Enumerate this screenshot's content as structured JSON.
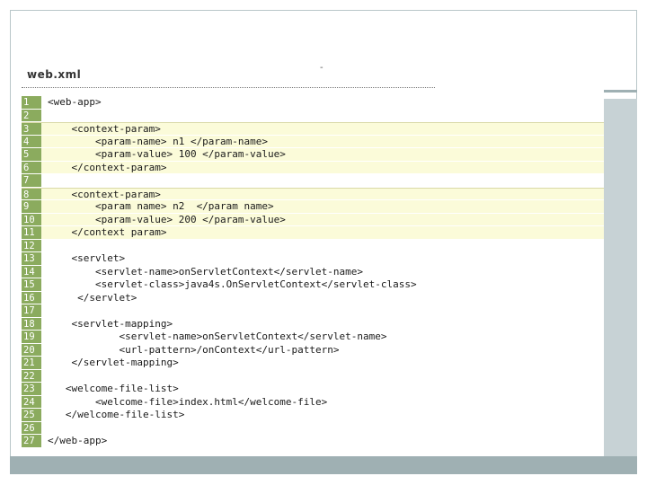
{
  "file_title": "web.xml",
  "dash_mark": "-",
  "colors": {
    "gutter": "#8bab5e",
    "highlight": "#fbfbd9",
    "frame_band": "#c7d2d5",
    "bottom_band": "#9fb0b3"
  },
  "code_lines": [
    {
      "num": "1",
      "text": "<web-app>",
      "hl": false
    },
    {
      "num": "2",
      "text": "",
      "hl": false
    },
    {
      "num": "3",
      "text": "    <context-param>",
      "hl": true
    },
    {
      "num": "4",
      "text": "        <param-name> n1 </param-name>",
      "hl": true
    },
    {
      "num": "5",
      "text": "        <param-value> 100 </param-value>",
      "hl": true
    },
    {
      "num": "6",
      "text": "    </context-param>",
      "hl": true
    },
    {
      "num": "7",
      "text": "",
      "hl": false
    },
    {
      "num": "8",
      "text": "    <context-param>",
      "hl": true
    },
    {
      "num": "9",
      "text": "        <param name> n2  </param name>",
      "hl": true
    },
    {
      "num": "10",
      "text": "        <param-value> 200 </param-value>",
      "hl": true
    },
    {
      "num": "11",
      "text": "    </context param>",
      "hl": true
    },
    {
      "num": "12",
      "text": "",
      "hl": false
    },
    {
      "num": "13",
      "text": "    <servlet>",
      "hl": false
    },
    {
      "num": "14",
      "text": "        <servlet-name>onServletContext</servlet-name>",
      "hl": false
    },
    {
      "num": "15",
      "text": "        <servlet-class>java4s.OnServletContext</servlet-class>",
      "hl": false
    },
    {
      "num": "16",
      "text": "     </servlet>",
      "hl": false
    },
    {
      "num": "17",
      "text": "",
      "hl": false
    },
    {
      "num": "18",
      "text": "    <servlet-mapping>",
      "hl": false
    },
    {
      "num": "19",
      "text": "            <servlet-name>onServletContext</servlet-name>",
      "hl": false
    },
    {
      "num": "20",
      "text": "            <url-pattern>/onContext</url-pattern>",
      "hl": false
    },
    {
      "num": "21",
      "text": "    </servlet-mapping>",
      "hl": false
    },
    {
      "num": "22",
      "text": "",
      "hl": false
    },
    {
      "num": "23",
      "text": "   <welcome-file-list>",
      "hl": false
    },
    {
      "num": "24",
      "text": "        <welcome-file>index.html</welcome-file>",
      "hl": false
    },
    {
      "num": "25",
      "text": "   </welcome-file-list>",
      "hl": false
    },
    {
      "num": "26",
      "text": "",
      "hl": false
    },
    {
      "num": "27",
      "text": "</web-app>",
      "hl": false
    }
  ]
}
